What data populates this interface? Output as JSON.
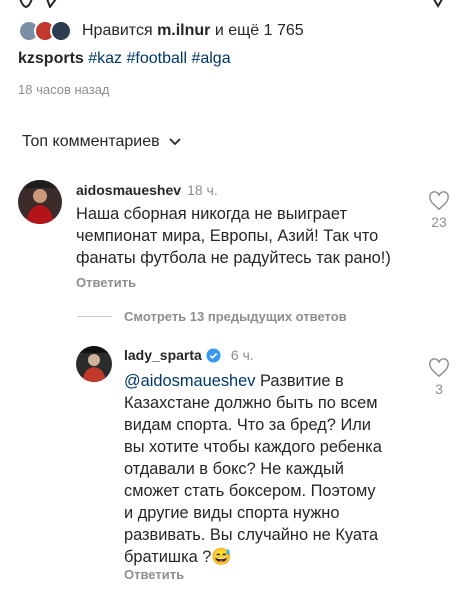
{
  "post": {
    "likes_prefix": "Нравится",
    "likes_user": "m.ilnur",
    "likes_suffix": "и ещё 1 765",
    "author": "kzsports",
    "hashtags": [
      "#kaz",
      "#football",
      "#alga"
    ],
    "time_ago": "18 часов назад"
  },
  "comments_header": {
    "sort_label": "Топ комментариев"
  },
  "comment": {
    "username": "aidosmaueshev",
    "time": "18 ч.",
    "text_lines": [
      "Наша сборная никогда не выиграет",
      "чемпионат мира, Европы, Азий! Так что",
      "фанаты футбола не радуйтесь так рано!)"
    ],
    "reply_label": "Ответить",
    "like_count": "23"
  },
  "view_replies": {
    "label": "Смотреть 13 предыдущих ответов"
  },
  "reply": {
    "username": "lady_sparta",
    "time": "6 ч.",
    "mention": "@aidosmaueshev",
    "text_lines": [
      "Развитие в",
      "Казахстане должно быть по всем",
      "видам спорта. Что за бред? Или",
      "вы хотите чтобы каждого ребенка",
      "отдавали в бокс? Не каждый",
      "сможет стать боксером. Поэтому",
      "и другие виды спорта нужно",
      "развивать. Вы случайно не Куата",
      "братишка ?😅"
    ],
    "reply_label": "Ответить",
    "like_count": "3"
  },
  "colors": {
    "text": "#262626",
    "secondary": "#8e8e8e",
    "link": "#00376b",
    "verified": "#3897f0"
  },
  "icons": [
    "heart-outline-icon",
    "like-icon",
    "comment-icon",
    "share-icon",
    "bookmark-icon",
    "chevron-down-icon",
    "verified-badge-icon"
  ]
}
